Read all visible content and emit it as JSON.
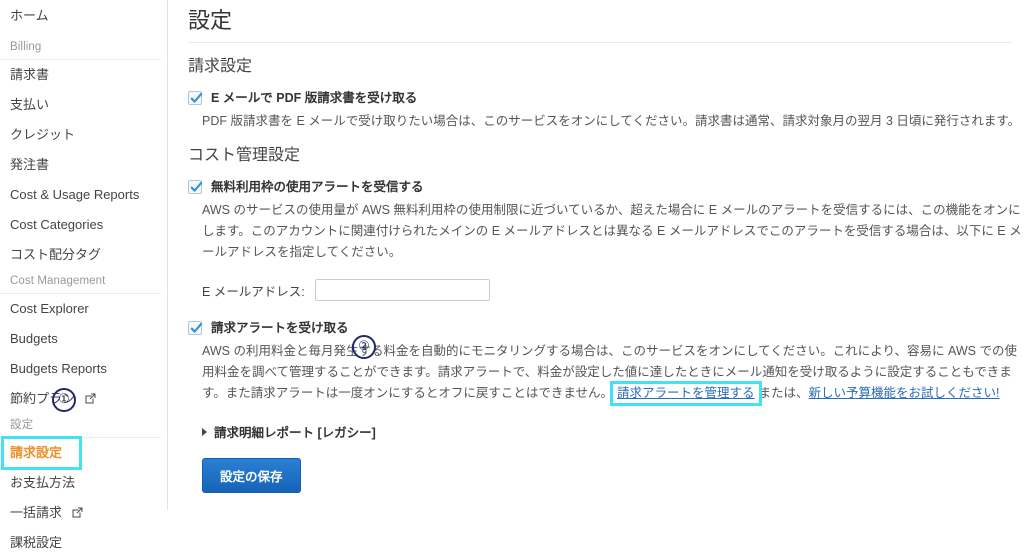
{
  "sidebar": {
    "home": {
      "label": "ホーム"
    },
    "sections": [
      {
        "heading": "Billing",
        "items": [
          {
            "label": "請求書",
            "external": false
          },
          {
            "label": "支払い",
            "external": false
          },
          {
            "label": "クレジット",
            "external": false
          },
          {
            "label": "発注書",
            "external": false
          },
          {
            "label": "Cost & Usage Reports",
            "external": false
          },
          {
            "label": "Cost Categories",
            "external": false
          },
          {
            "label": "コスト配分タグ",
            "external": false
          }
        ]
      },
      {
        "heading": "Cost Management",
        "items": [
          {
            "label": "Cost Explorer",
            "external": false
          },
          {
            "label": "Budgets",
            "external": false
          },
          {
            "label": "Budgets Reports",
            "external": false
          },
          {
            "label": "節約プラン",
            "external": true
          }
        ]
      },
      {
        "heading": "設定",
        "items": [
          {
            "label": "請求設定",
            "external": false,
            "active": true
          },
          {
            "label": "お支払方法",
            "external": false
          },
          {
            "label": "一括請求",
            "external": true
          },
          {
            "label": "課税設定",
            "external": false
          }
        ]
      }
    ]
  },
  "annotations": {
    "step1": "①",
    "step2": "②",
    "highlight_color": "#42e2f4",
    "marker_color": "#1b2a6b",
    "active_text_color": "#e8912d"
  },
  "main": {
    "page_title": "設定",
    "billing_section": {
      "title": "請求設定",
      "checkbox_label": "E メールで PDF 版請求書を受け取る",
      "checked": true,
      "description": "PDF 版請求書を E メールで受け取りたい場合は、このサービスをオンにしてください。請求書は通常、請求対象月の翌月 3 日頃に発行されます。"
    },
    "cost_section": {
      "title": "コスト管理設定",
      "free_tier": {
        "checkbox_label": "無料利用枠の使用アラートを受信する",
        "checked": true,
        "description": "AWS のサービスの使用量が AWS 無料利用枠の使用制限に近づいているか、超えた場合に E メールのアラートを受信するには、この機能をオンにします。このアカウントに関連付けられたメインの E メールアドレスとは異なる E メールアドレスでこのアラートを受信する場合は、以下に E メールアドレスを指定してください。",
        "email_label": "E メールアドレス:",
        "email_value": "",
        "email_placeholder": ""
      },
      "billing_alert": {
        "checkbox_label": "請求アラートを受け取る",
        "checked": true,
        "description_part1": "AWS の利用料金と毎月発生する料金を自動的にモニタリングする場合は、このサービスをオンにしてください。これにより、容易に AWS での使用料金を調べて管理することができます。請求アラートで、料金が設定した値に達したときにメール通知を受け取るように設定することもできます。また請求アラートは一度オンにするとオフに戻すことはできません。",
        "link_manage": "請求アラートを管理する",
        "between_text": "または、",
        "link_budgets": "新しい予算機能をお試しください!"
      }
    },
    "legacy_report": {
      "label": "請求明細レポート [レガシー]"
    },
    "save_button": "設定の保存"
  }
}
